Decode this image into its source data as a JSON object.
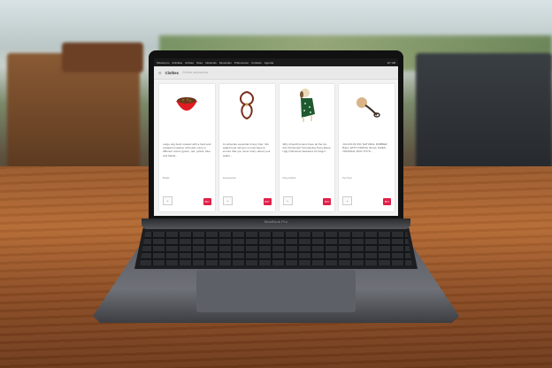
{
  "brand_label": "MacBook Pro",
  "app": {
    "menu_items": [
      "Showroom",
      "Activities",
      "Articles",
      "Store",
      "Networks",
      "Favourites",
      "Preferences",
      "Contacts",
      "Agenda"
    ],
    "status_text": "ET  GB",
    "page_title": "Clothes",
    "page_subtitle": "Clothes accessories"
  },
  "products": [
    {
      "icon": "dog-bowl-icon",
      "description": "Large dog bowl created with a hard and resistant material. All bowls come in different colors (green, red, yellow, blue and black)...",
      "category": "Bowls",
      "qty_label": "+",
      "buy_label": "BUY"
    },
    {
      "icon": "leash-icon",
      "description": "An absolute essential of any rider, this wallet book string is a must have to ensure that you never worry about your wallet...",
      "category": "Accessories",
      "qty_label": "+",
      "buy_label": "BUY"
    },
    {
      "icon": "dog-sweater-icon",
      "description": "Why should humans have all the fun this Christmas? Introducing Tipsy Elves' Ugly Christmas Sweaters for Dogs!...",
      "category": "Dog clothes",
      "qty_label": "+",
      "buy_label": "BUY"
    },
    {
      "icon": "rubber-ball-rope-icon",
      "description": "JULIUS-K9 IDC NATURAL RUBBER BALL WITH STRING IN ALL SIZES - ORIGINAL DOG TOYS...",
      "category": "Pet Toys",
      "qty_label": "+",
      "buy_label": "BUY"
    }
  ],
  "colors": {
    "buy": "#e0204a",
    "table_wood": "#b56a33",
    "laptop": "#5a5d63"
  }
}
